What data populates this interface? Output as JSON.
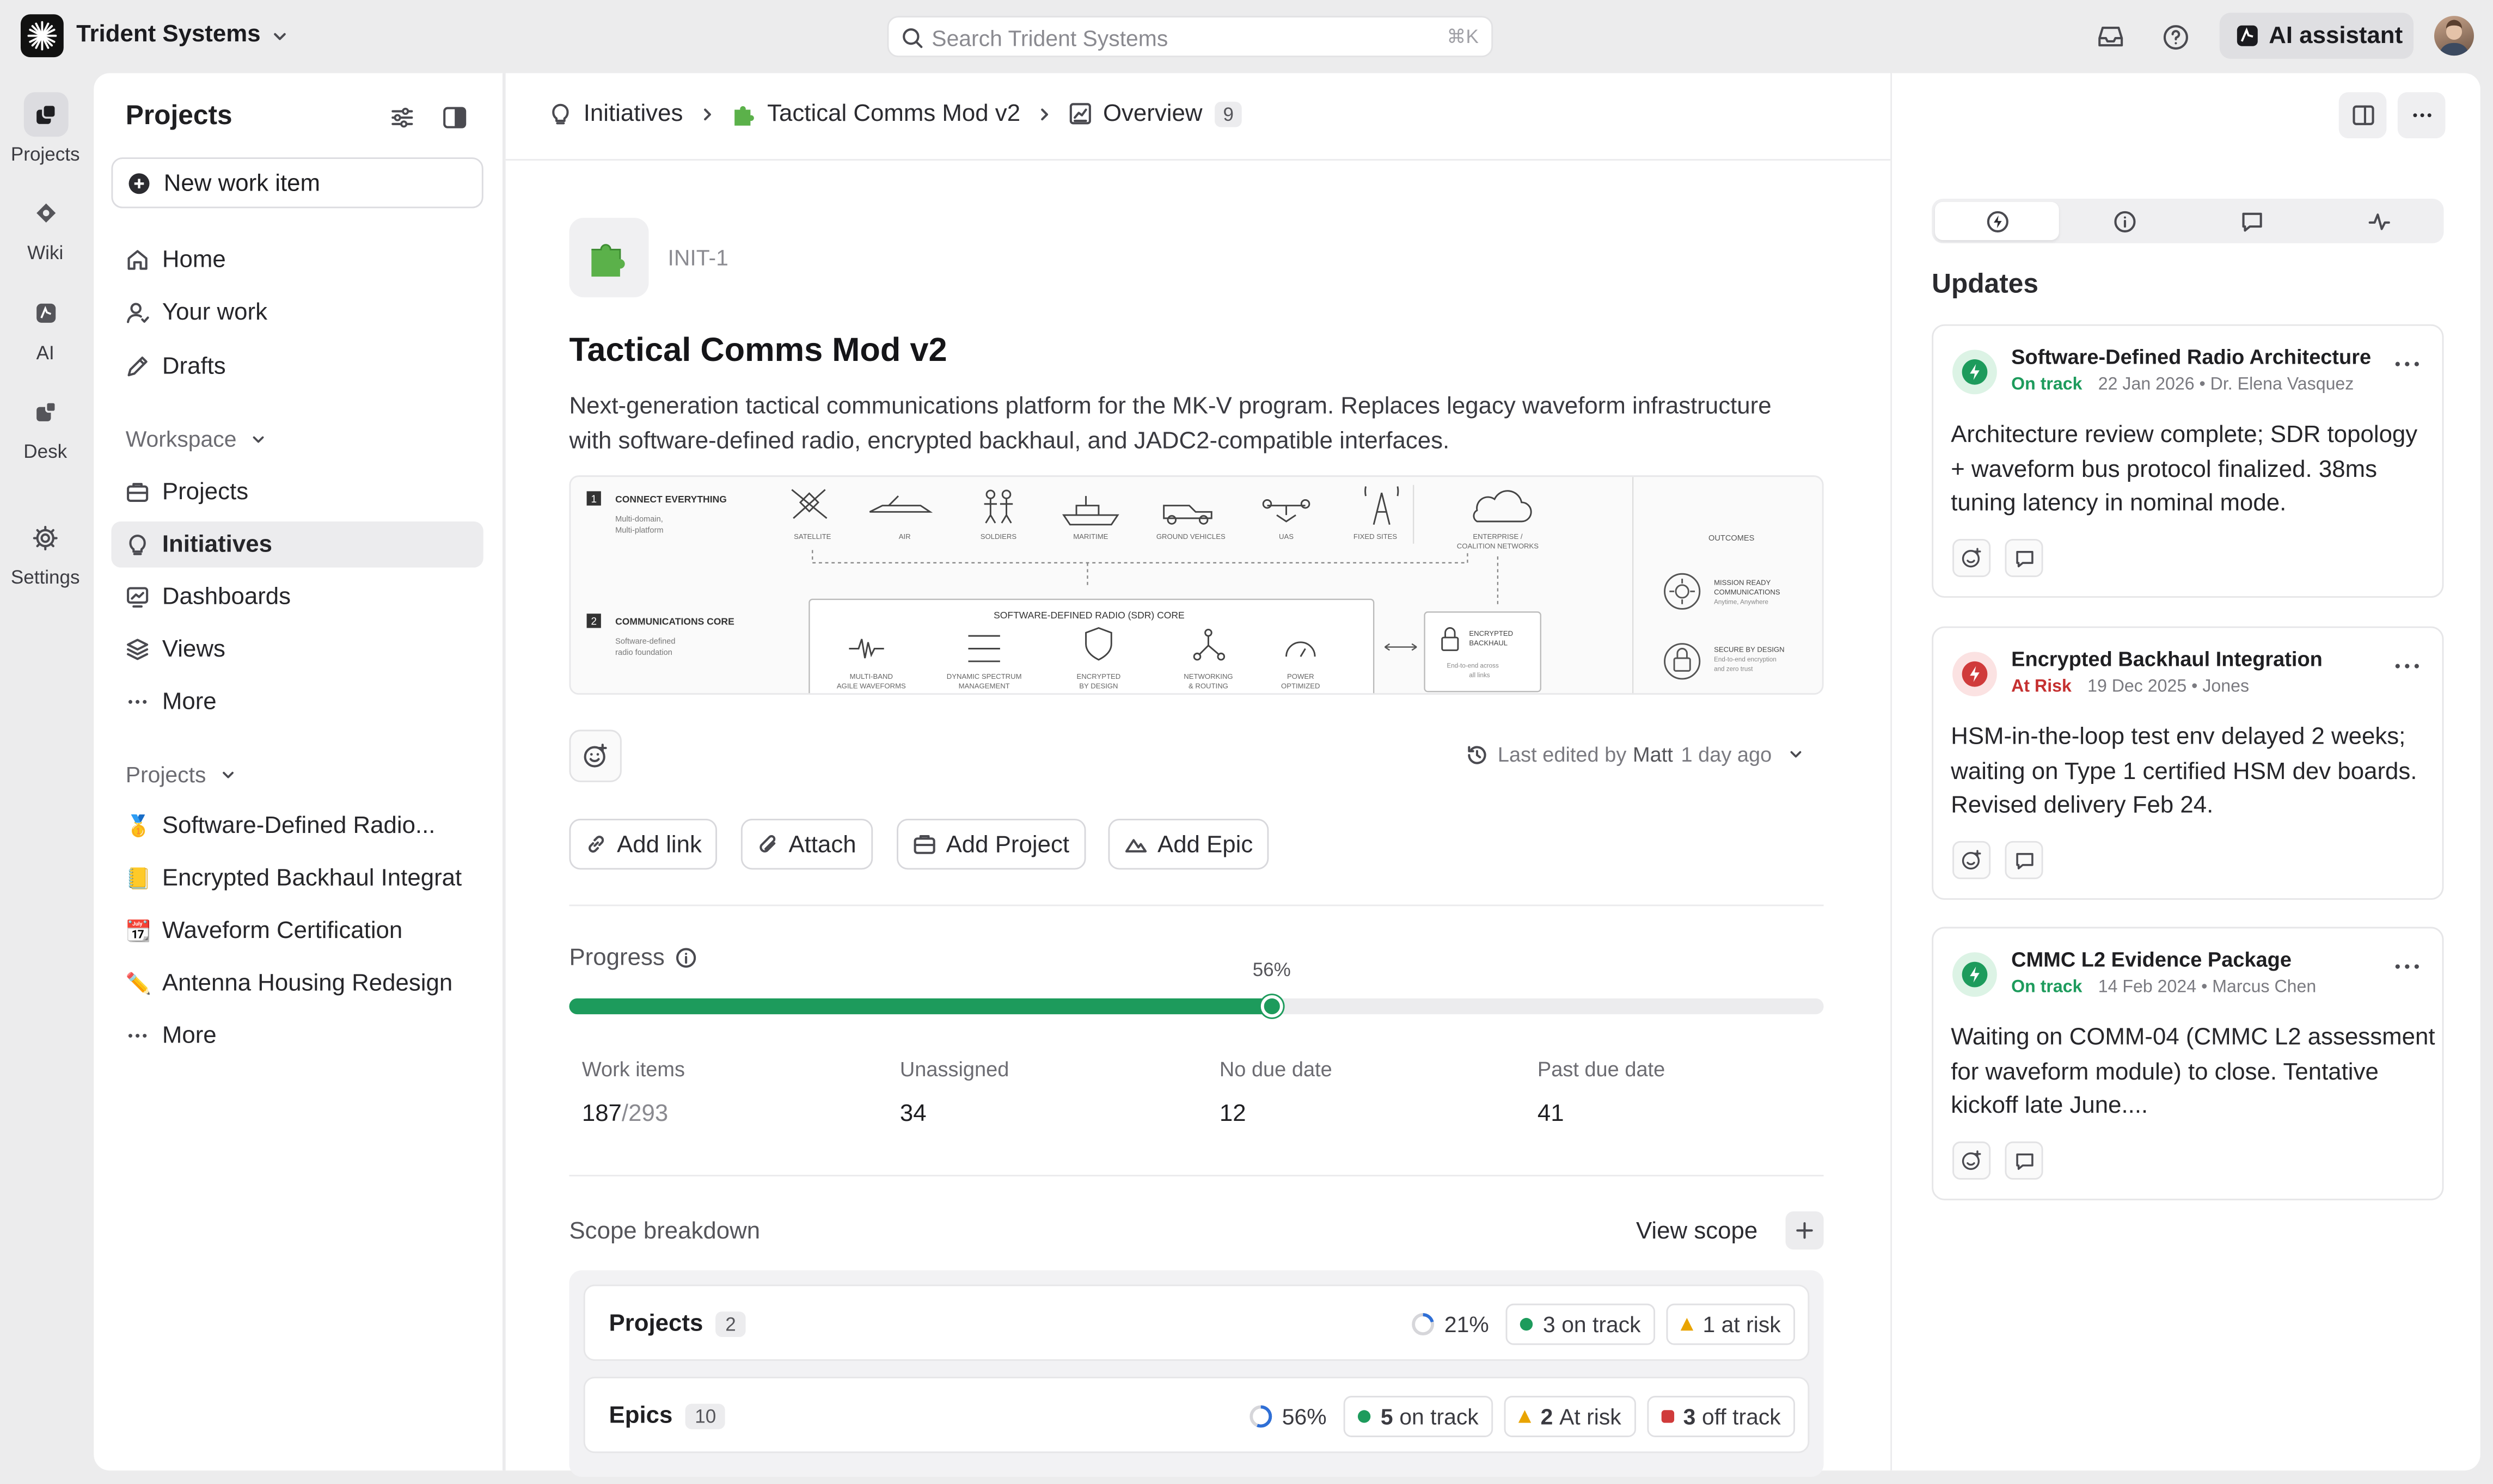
{
  "app": {
    "workspace": "Trident Systems",
    "search_placeholder": "Search Trident Systems",
    "search_shortcut": "⌘K",
    "ai_label": "AI assistant"
  },
  "rail": [
    {
      "label": "Projects",
      "icon": "projects-icon"
    },
    {
      "label": "Wiki",
      "icon": "wiki-icon"
    },
    {
      "label": "AI",
      "icon": "ai-icon"
    },
    {
      "label": "Desk",
      "icon": "desk-icon"
    },
    {
      "label": "Settings",
      "icon": "settings-icon"
    }
  ],
  "sidebar": {
    "title": "Projects",
    "new_item": "New work item",
    "nav": [
      "Home",
      "Your work",
      "Drafts"
    ],
    "workspace_label": "Workspace",
    "workspace_items": [
      "Projects",
      "Initiatives",
      "Dashboards",
      "Views",
      "More"
    ],
    "projects_label": "Projects",
    "projects": [
      {
        "emoji": "🥇",
        "label": "Software-Defined Radio..."
      },
      {
        "emoji": "📒",
        "label": "Encrypted Backhaul Integrat"
      },
      {
        "emoji": "📆",
        "label": "Waveform Certification"
      },
      {
        "emoji": "✏️",
        "label": "Antenna Housing Redesign"
      },
      {
        "emoji": "",
        "label": "More"
      }
    ]
  },
  "breadcrumb": {
    "root": "Initiatives",
    "item": "Tactical Comms Mod v2",
    "page": "Overview",
    "count": "9"
  },
  "initiative": {
    "id": "INIT-1",
    "title": "Tactical Comms Mod v2",
    "description": "Next-generation tactical communications platform for the MK-V program. Replaces legacy waveform infrastructure with software-defined radio, encrypted backhaul, and JADC2-compatible interfaces.",
    "edited_prefix": "Last edited by",
    "edited_by": "Matt",
    "edited_when": "1 day ago"
  },
  "diagram": {
    "s1_num": "1",
    "s1_title": "CONNECT EVERYTHING",
    "s1_sub1": "Multi-domain,",
    "s1_sub2": "Multi-platform",
    "nodes": [
      "SATELLITE",
      "AIR",
      "SOLDIERS",
      "MARITIME",
      "GROUND VEHICLES",
      "UAS",
      "FIXED SITES"
    ],
    "enterprise1": "ENTERPRISE /",
    "enterprise2": "COALITION NETWORKS",
    "s2_num": "2",
    "s2_title": "COMMUNICATIONS CORE",
    "s2_sub1": "Software-defined",
    "s2_sub2": "radio foundation",
    "core_title": "SOFTWARE-DEFINED RADIO (SDR) CORE",
    "core_items": [
      [
        "MULTI-BAND",
        "AGILE WAVEFORMS"
      ],
      [
        "DYNAMIC SPECTRUM",
        "MANAGEMENT"
      ],
      [
        "ENCRYPTED",
        "BY DESIGN"
      ],
      [
        "NETWORKING",
        "& ROUTING"
      ],
      [
        "POWER",
        "OPTIMIZED"
      ]
    ],
    "backhaul": [
      "ENCRYPTED",
      "BACKHAUL",
      "End-to-end across",
      "all links"
    ],
    "outcomes_title": "OUTCOMES",
    "outcome1": [
      "MISSION READY",
      "COMMUNICATIONS",
      "Anytime, Anywhere"
    ],
    "outcome2": [
      "SECURE BY DESIGN",
      "End-to-end encryption",
      "and zero trust"
    ]
  },
  "actions": [
    "Add link",
    "Attach",
    "Add Project",
    "Add Epic"
  ],
  "progress": {
    "label": "Progress",
    "percent_text": "56%",
    "value": 0.56
  },
  "stats": [
    {
      "label": "Work items",
      "value": "187",
      "total": "/293"
    },
    {
      "label": "Unassigned",
      "value": "34",
      "total": ""
    },
    {
      "label": "No due date",
      "value": "12",
      "total": ""
    },
    {
      "label": "Past due date",
      "value": "41",
      "total": ""
    }
  ],
  "scope": {
    "label": "Scope breakdown",
    "view": "View scope",
    "rows": [
      {
        "name": "Projects",
        "count": "2",
        "pct": "21%",
        "pct_value": 0.21,
        "chips": [
          {
            "kind": "on",
            "num": "3",
            "text": "on track"
          },
          {
            "kind": "risk",
            "num": "1",
            "text": "at risk"
          }
        ]
      },
      {
        "name": "Epics",
        "count": "10",
        "pct": "56%",
        "pct_value": 0.56,
        "chips": [
          {
            "kind": "on",
            "num": "5",
            "text": "on track"
          },
          {
            "kind": "risk",
            "num": "2",
            "text": "At risk"
          },
          {
            "kind": "off",
            "num": "3",
            "text": "off track"
          }
        ]
      }
    ]
  },
  "updates": {
    "title": "Updates",
    "items": [
      {
        "title": "Software-Defined Radio Architecture",
        "status": "On track",
        "status_color": "#1d9b5c",
        "date": "22 Jan 2026 • Dr. Elena Vasquez",
        "body": "Architecture review complete; SDR topology + waveform bus protocol finalized. 38ms tuning latency in nominal mode."
      },
      {
        "title": "Encrypted Backhaul Integration",
        "status": "At Risk",
        "status_color": "#d03b3b",
        "date": "19 Dec 2025 • Jones",
        "body": "HSM-in-the-loop test env delayed 2 weeks; waiting on Type 1 certified HSM dev boards. Revised delivery Feb 24."
      },
      {
        "title": "CMMC L2 Evidence Package",
        "status": "On track",
        "status_color": "#1d9b5c",
        "date": "14 Feb 2024 • Marcus Chen",
        "body": "Waiting on COMM-04 (CMMC L2 assessment for waveform module) to close. Tentative kickoff late June...."
      }
    ]
  },
  "colors": {
    "accent_green": "#1d9b5c",
    "risk_amber": "#e9a400",
    "off_red": "#d03b3b"
  }
}
